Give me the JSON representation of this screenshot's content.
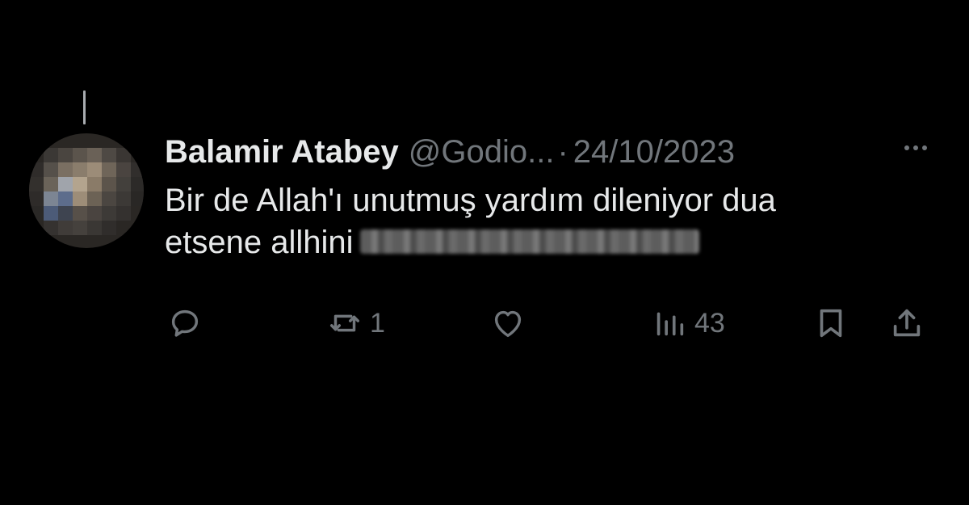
{
  "tweet": {
    "display_name": "Balamir Atabey",
    "handle": "@Godio...",
    "separator": "·",
    "date": "24/10/2023",
    "text_line1": "Bir de Allah'ı unutmuş yardım dileniyor dua",
    "text_line2": "etsene allhini"
  },
  "actions": {
    "reply_icon": "reply-icon",
    "retweet_icon": "retweet-icon",
    "retweet_count": "1",
    "like_icon": "heart-icon",
    "views_icon": "views-icon",
    "views_count": "43",
    "bookmark_icon": "bookmark-icon",
    "share_icon": "share-icon"
  },
  "colors": {
    "background": "#000000",
    "text": "#e7e9ea",
    "secondary": "#71767b"
  }
}
